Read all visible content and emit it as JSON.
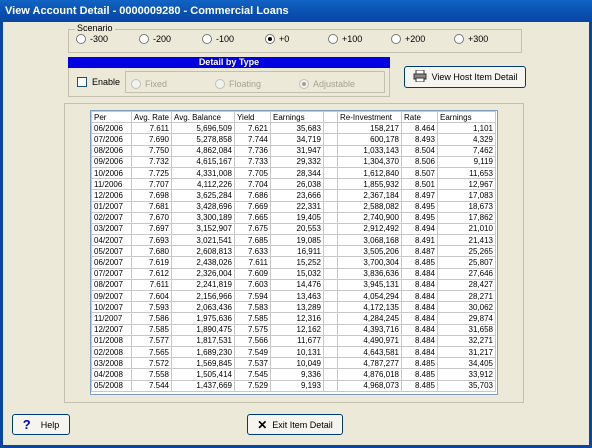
{
  "window": {
    "title": "View Account Detail - 0000009280 - Commercial Loans"
  },
  "scenario": {
    "label": "Scenario",
    "options": [
      "-300",
      "-200",
      "-100",
      "+0",
      "+100",
      "+200",
      "+300"
    ],
    "selected": "+0"
  },
  "detail": {
    "header": "Detail by Type",
    "enable_label": "Enable",
    "options": [
      "Fixed",
      "Floating",
      "Adjustable"
    ],
    "selected": "Adjustable"
  },
  "buttons": {
    "host_item": "View Host Item Detail",
    "help": "Help",
    "exit": "Exit Item Detail"
  },
  "table": {
    "columns": [
      "Per",
      "Avg. Rate",
      "Avg. Balance",
      "Yield",
      "Earnings",
      "",
      "Re-Investment",
      "Rate",
      "Earnings"
    ],
    "rows": [
      [
        "06/2006",
        "7.611",
        "5,696,509",
        "7.621",
        "35,683",
        "",
        "158,217",
        "8.464",
        "1,101"
      ],
      [
        "07/2006",
        "7.690",
        "5,278,858",
        "7.744",
        "34,719",
        "",
        "600,178",
        "8.493",
        "4,329"
      ],
      [
        "08/2006",
        "7.750",
        "4,862,084",
        "7.736",
        "31,947",
        "",
        "1,033,143",
        "8.504",
        "7,462"
      ],
      [
        "09/2006",
        "7.732",
        "4,615,167",
        "7.733",
        "29,332",
        "",
        "1,304,370",
        "8.506",
        "9,119"
      ],
      [
        "10/2006",
        "7.725",
        "4,331,008",
        "7.705",
        "28,344",
        "",
        "1,612,840",
        "8.507",
        "11,653"
      ],
      [
        "11/2006",
        "7.707",
        "4,112,226",
        "7.704",
        "26,038",
        "",
        "1,855,932",
        "8.501",
        "12,967"
      ],
      [
        "12/2006",
        "7.698",
        "3,625,284",
        "7.686",
        "23,666",
        "",
        "2,367,184",
        "8.497",
        "17,083"
      ],
      [
        "01/2007",
        "7.681",
        "3,428,696",
        "7.669",
        "22,331",
        "",
        "2,588,082",
        "8.495",
        "18,673"
      ],
      [
        "02/2007",
        "7.670",
        "3,300,189",
        "7.665",
        "19,405",
        "",
        "2,740,900",
        "8.495",
        "17,862"
      ],
      [
        "03/2007",
        "7.697",
        "3,152,907",
        "7.675",
        "20,553",
        "",
        "2,912,492",
        "8.494",
        "21,010"
      ],
      [
        "04/2007",
        "7.693",
        "3,021,541",
        "7.685",
        "19,085",
        "",
        "3,068,168",
        "8.491",
        "21,413"
      ],
      [
        "05/2007",
        "7.680",
        "2,608,813",
        "7.633",
        "16,911",
        "",
        "3,505,206",
        "8.487",
        "25,265"
      ],
      [
        "06/2007",
        "7.619",
        "2,438,026",
        "7.611",
        "15,252",
        "",
        "3,700,304",
        "8.485",
        "25,807"
      ],
      [
        "07/2007",
        "7.612",
        "2,326,004",
        "7.609",
        "15,032",
        "",
        "3,836,636",
        "8.484",
        "27,646"
      ],
      [
        "08/2007",
        "7.611",
        "2,241,819",
        "7.603",
        "14,476",
        "",
        "3,945,131",
        "8.484",
        "28,427"
      ],
      [
        "09/2007",
        "7.604",
        "2,156,966",
        "7.594",
        "13,463",
        "",
        "4,054,294",
        "8.484",
        "28,271"
      ],
      [
        "10/2007",
        "7.593",
        "2,063,436",
        "7.583",
        "13,289",
        "",
        "4,172,135",
        "8.484",
        "30,062"
      ],
      [
        "11/2007",
        "7.586",
        "1,975,636",
        "7.585",
        "12,316",
        "",
        "4,284,245",
        "8.484",
        "29,874"
      ],
      [
        "12/2007",
        "7.585",
        "1,890,475",
        "7.575",
        "12,162",
        "",
        "4,393,716",
        "8.484",
        "31,658"
      ],
      [
        "01/2008",
        "7.577",
        "1,817,531",
        "7.566",
        "11,677",
        "",
        "4,490,971",
        "8.484",
        "32,271"
      ],
      [
        "02/2008",
        "7.565",
        "1,689,230",
        "7.549",
        "10,131",
        "",
        "4,643,581",
        "8.484",
        "31,217"
      ],
      [
        "03/2008",
        "7.572",
        "1,569,845",
        "7.537",
        "10,049",
        "",
        "4,787,277",
        "8.485",
        "34,405"
      ],
      [
        "04/2008",
        "7.558",
        "1,505,414",
        "7.545",
        "9,336",
        "",
        "4,876,018",
        "8.485",
        "33,912"
      ],
      [
        "05/2008",
        "7.544",
        "1,437,669",
        "7.529",
        "9,193",
        "",
        "4,968,073",
        "8.485",
        "35,703"
      ]
    ]
  }
}
